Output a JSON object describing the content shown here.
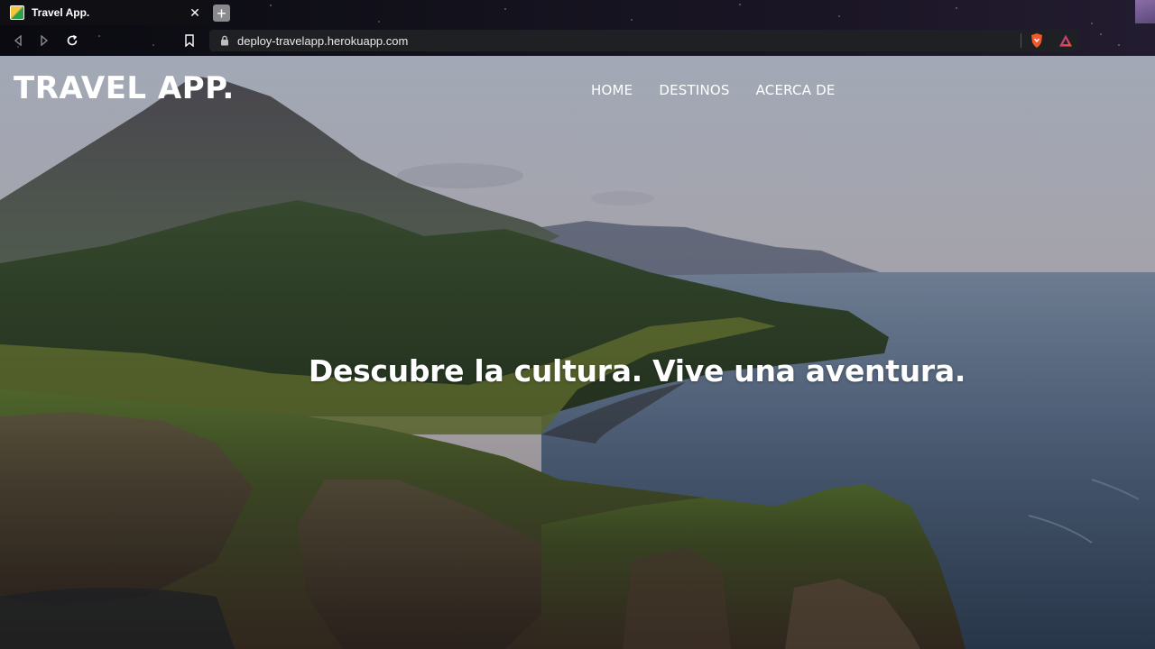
{
  "browser": {
    "tab": {
      "title": "Travel App.",
      "close_glyph": "✕",
      "favicon": "travel-app-favicon"
    },
    "new_tab_glyph": "+",
    "address": {
      "url": "deploy-travelapp.herokuapp.com"
    },
    "icons": {
      "back": "back-arrow-icon",
      "forward": "forward-arrow-icon",
      "reload": "reload-icon",
      "bookmark": "bookmark-icon",
      "lock": "lock-icon",
      "shield": "brave-shield-icon",
      "rewards": "brave-rewards-icon"
    }
  },
  "site": {
    "brand": "TRAVEL APP.",
    "nav": [
      {
        "label": "HOME"
      },
      {
        "label": "DESTINOS"
      },
      {
        "label": "ACERCA DE"
      }
    ],
    "hero": {
      "title": "Descubre la cultura. Vive una aventura."
    }
  },
  "colors": {
    "brand_text": "#ffffff",
    "address_bar": "#1f2023",
    "sky": "#b9b9c4",
    "sea": "#5b6e86"
  }
}
